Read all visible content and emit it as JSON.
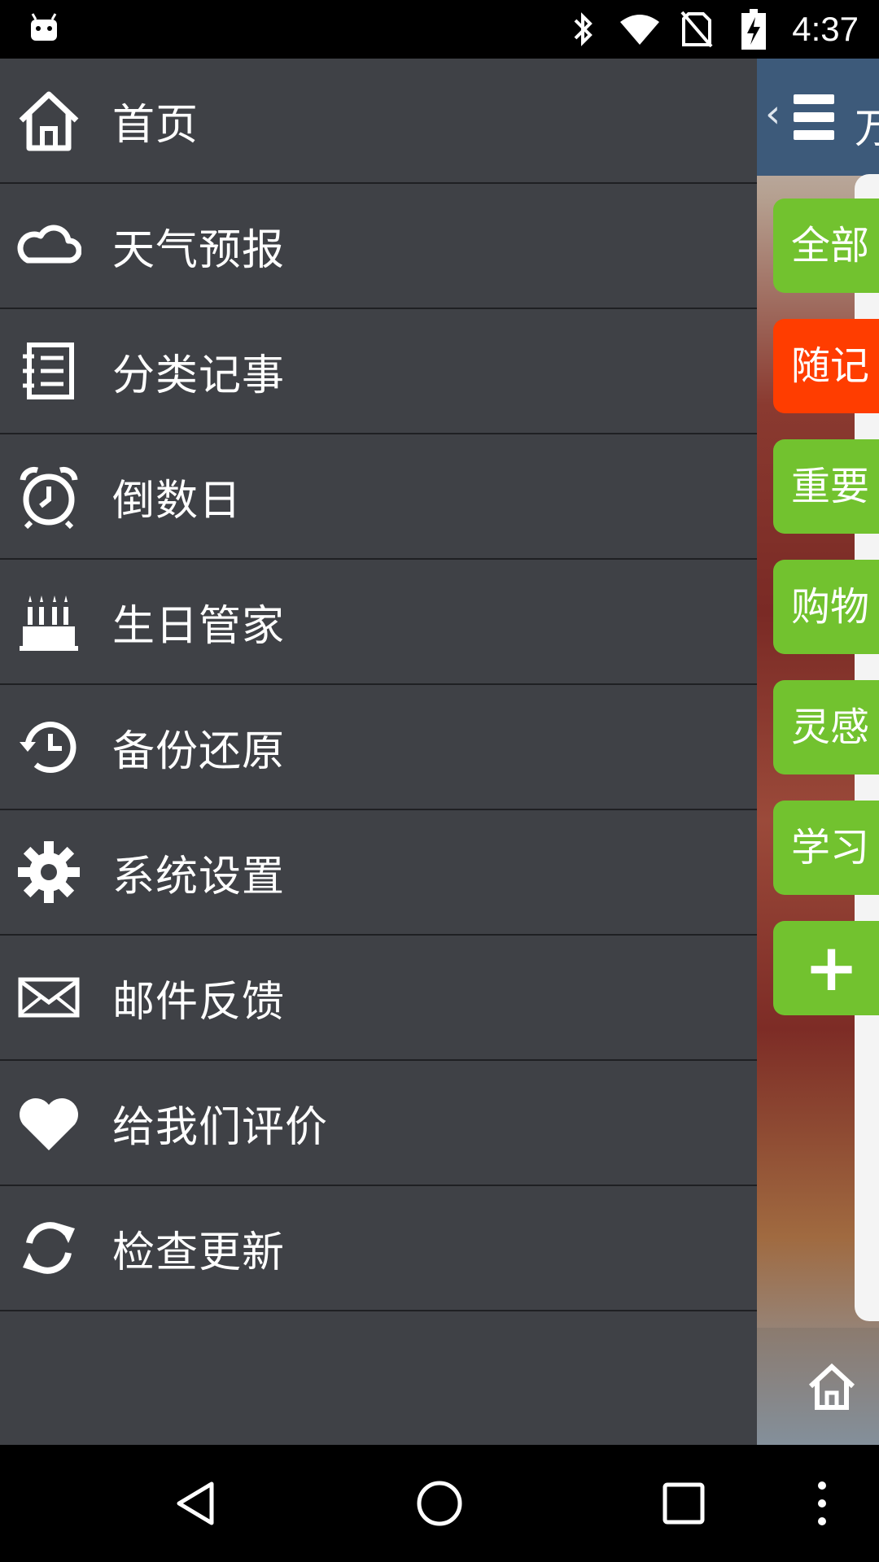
{
  "status_bar": {
    "time": "4:37",
    "icons": [
      "android-icon",
      "bluetooth-icon",
      "wifi-icon",
      "no-sim-icon",
      "battery-charging-icon"
    ]
  },
  "drawer": {
    "items": [
      {
        "label": "首页",
        "icon": "home-icon"
      },
      {
        "label": "天气预报",
        "icon": "cloud-icon"
      },
      {
        "label": "分类记事",
        "icon": "notebook-icon"
      },
      {
        "label": "倒数日",
        "icon": "alarm-clock-icon"
      },
      {
        "label": "生日管家",
        "icon": "birthday-cake-icon"
      },
      {
        "label": "备份还原",
        "icon": "history-icon"
      },
      {
        "label": "系统设置",
        "icon": "gear-icon"
      },
      {
        "label": "邮件反馈",
        "icon": "envelope-icon"
      },
      {
        "label": "给我们评价",
        "icon": "heart-icon"
      },
      {
        "label": "检查更新",
        "icon": "refresh-icon"
      }
    ]
  },
  "background_app": {
    "back_glyph": "‹",
    "title": "万",
    "categories": [
      {
        "label": "全部",
        "color": "#72c22f"
      },
      {
        "label": "随记",
        "color": "#ff3d00"
      },
      {
        "label": "重要",
        "color": "#72c22f"
      },
      {
        "label": "购物",
        "color": "#72c22f"
      },
      {
        "label": "灵感",
        "color": "#72c22f"
      },
      {
        "label": "学习",
        "color": "#72c22f"
      },
      {
        "label": "+",
        "color": "#72c22f"
      }
    ]
  },
  "navigation": {
    "icons": [
      "back-triangle-icon",
      "home-circle-icon",
      "recents-square-icon",
      "overflow-menu-icon"
    ]
  },
  "colors": {
    "drawer_bg": "#3f4146",
    "divider": "#1f2023",
    "accent_green": "#72c22f",
    "accent_red": "#ff3d00"
  }
}
